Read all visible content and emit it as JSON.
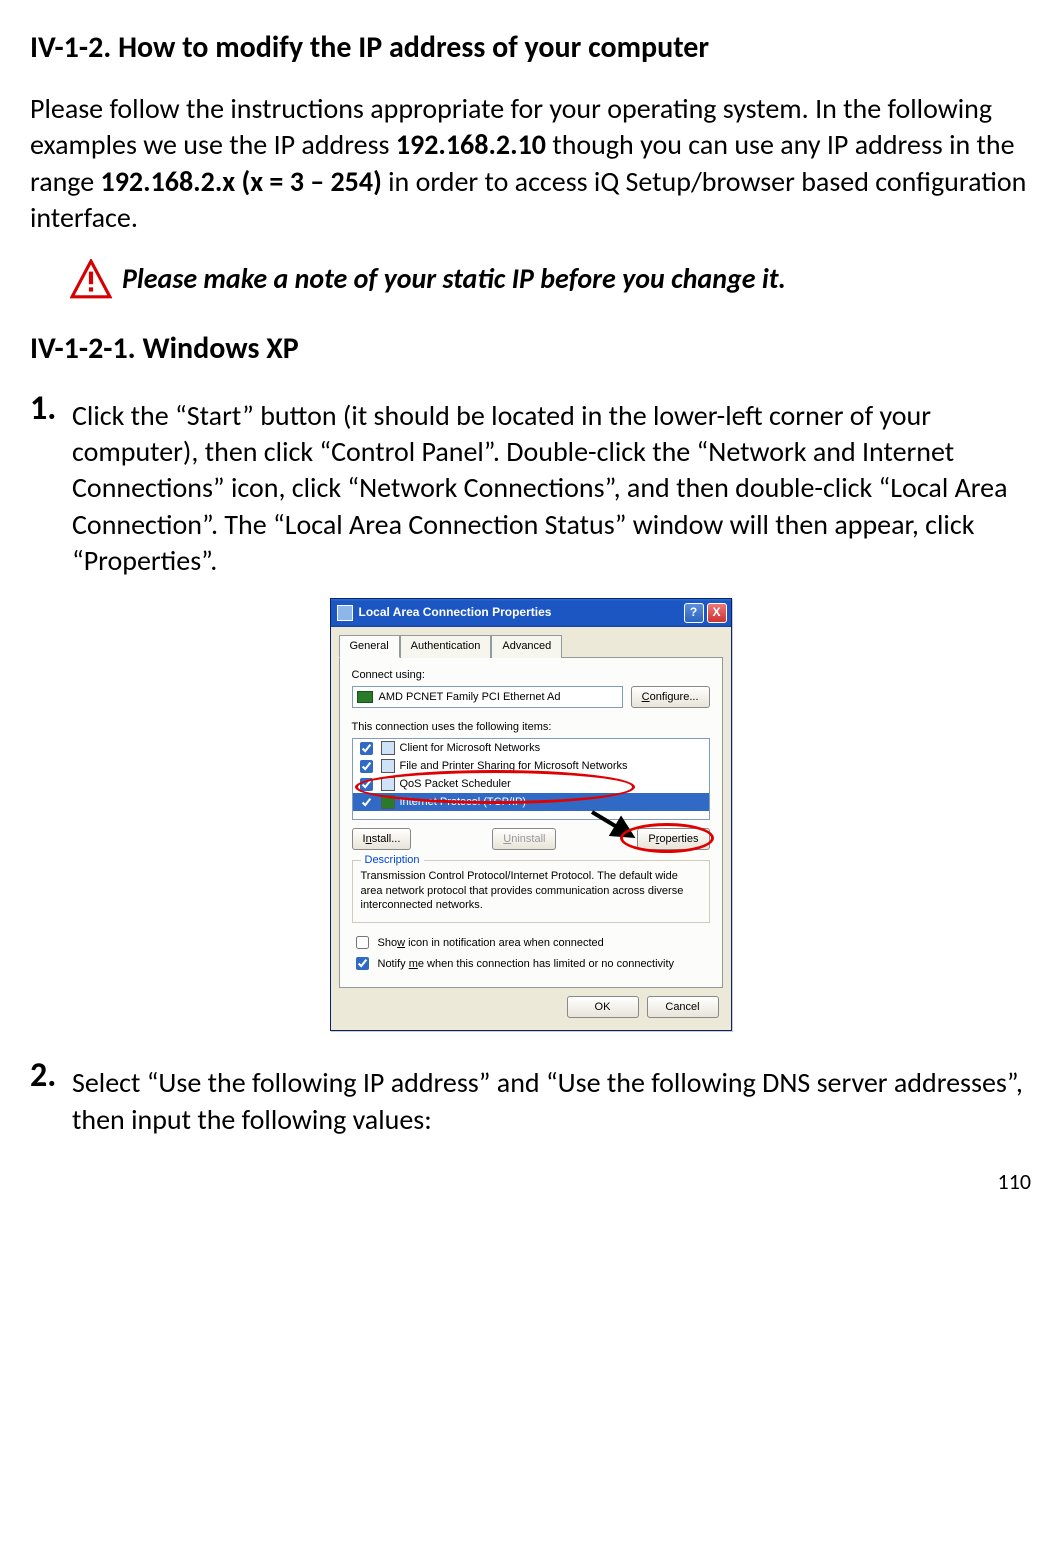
{
  "heading_main": "IV-1-2. How to modify the IP address of your computer",
  "intro": {
    "pre": "Please follow the instructions appropriate for your operating system. In the following examples we use the IP address ",
    "ip_example": "192.168.2.10",
    "mid": " though you can use any IP address in the range ",
    "ip_range": "192.168.2.x (x = 3 – 254)",
    "post": " in order to access iQ Setup/browser based configuration interface."
  },
  "warning_note": "Please make a note of your static IP before you change it.",
  "subsection_heading": "IV-1-2-1.    Windows XP",
  "step1": {
    "num": "1.",
    "text": "Click the “Start” button (it should be located in the lower-left corner of your computer), then click “Control Panel”. Double-click the “Network and Internet Connections” icon, click “Network Connections”, and then double-click “Local Area Connection”. The “Local Area Connection Status” window will then appear, click “Properties”."
  },
  "step2": {
    "num": "2.",
    "text": "Select “Use the following IP address” and “Use the following DNS server addresses”, then input the following values:"
  },
  "page_number": "110",
  "dialog": {
    "title": "Local Area Connection Properties",
    "help_glyph": "?",
    "close_glyph": "X",
    "tabs": {
      "general": "General",
      "auth": "Authentication",
      "advanced": "Advanced"
    },
    "connect_using_label": "Connect using:",
    "adapter_name": "AMD PCNET Family PCI Ethernet Ad",
    "configure_btn": "Configure...",
    "items_label": "This connection uses the following items:",
    "items": [
      {
        "label": "Client for Microsoft Networks",
        "checked": true,
        "selected": false
      },
      {
        "label": "File and Printer Sharing for Microsoft Networks",
        "checked": true,
        "selected": false
      },
      {
        "label": "QoS Packet Scheduler",
        "checked": true,
        "selected": false
      },
      {
        "label": "Internet Protocol (TCP/IP)",
        "checked": true,
        "selected": true
      }
    ],
    "install_btn": "Install...",
    "uninstall_btn": "Uninstall",
    "properties_btn": "Properties",
    "description_label": "Description",
    "description_text": "Transmission Control Protocol/Internet Protocol. The default wide area network protocol that provides communication across diverse interconnected networks.",
    "show_icon_label": "Show icon in notification area when connected",
    "notify_label": "Notify me when this connection has limited or no connectivity",
    "ok_btn": "OK",
    "cancel_btn": "Cancel"
  }
}
